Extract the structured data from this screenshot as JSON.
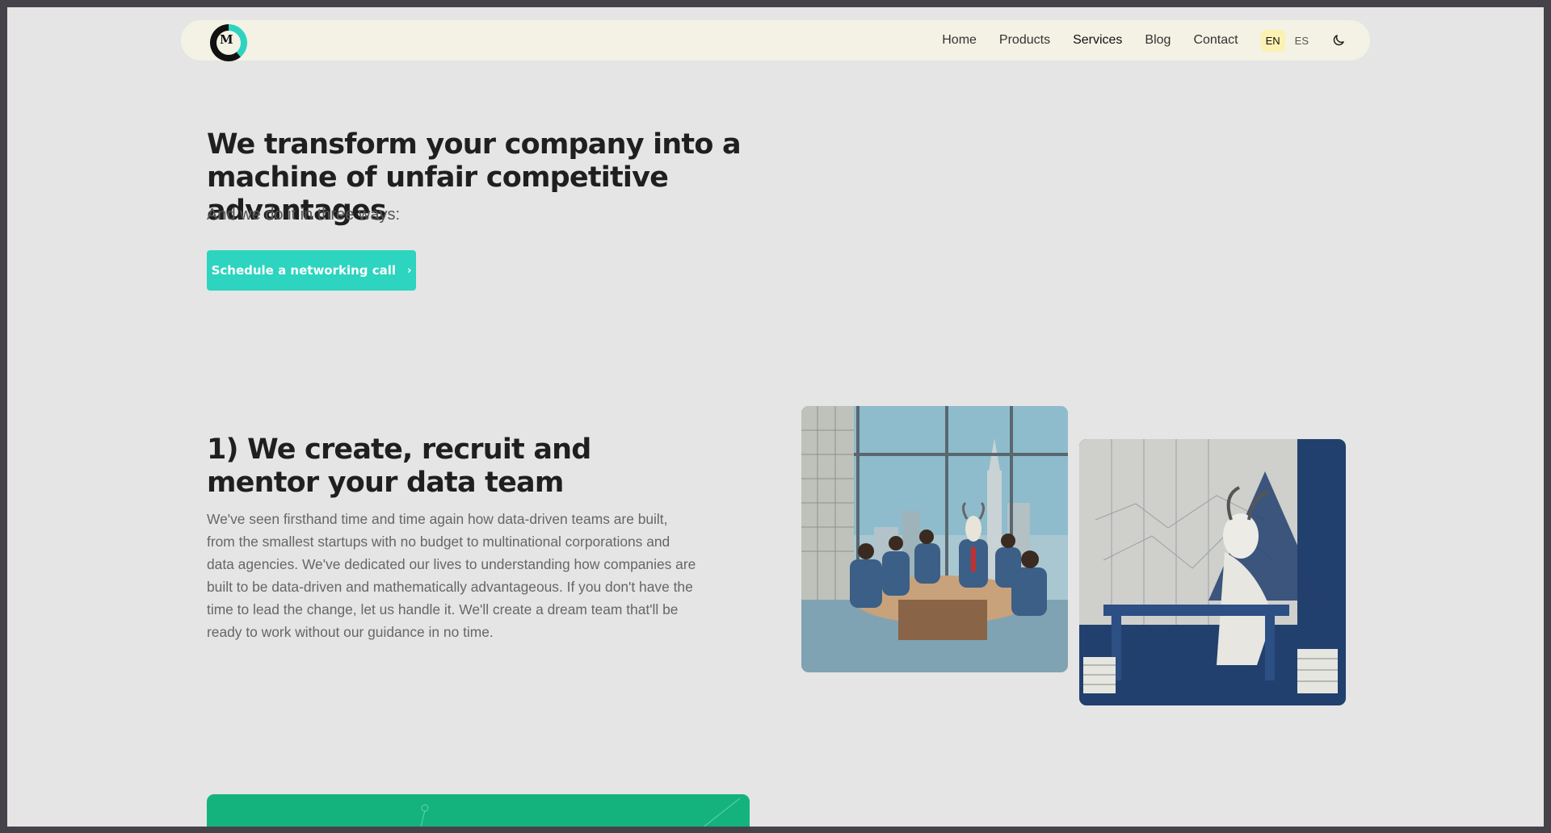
{
  "nav": {
    "logo_text": "M",
    "links": [
      {
        "label": "Home"
      },
      {
        "label": "Products"
      },
      {
        "label": "Services"
      },
      {
        "label": "Blog"
      },
      {
        "label": "Contact"
      }
    ],
    "languages": [
      "EN",
      "ES"
    ]
  },
  "hero": {
    "title": "We transform your company into a machine of unfair competitive advantages",
    "subtitle": "And we do it in three ways:",
    "cta_label": "Schedule a networking call"
  },
  "section1": {
    "title": "1) We create, recruit and mentor your data team",
    "body": "We've seen firsthand time and time again how data-driven teams are built, from the smallest startups with no budget to multinational corporations and data agencies. We've dedicated our lives to understanding how companies are built to be data-driven and mathematically advantageous. If you don't have the time to lead the change, let us handle it. We'll create a dream team that'll be ready to work without our guidance in no time."
  },
  "colors": {
    "accent": "#2dd4bf",
    "nav_bg": "#f3f2e4",
    "page_bg": "#e5e5e5",
    "green_card": "#14b37d",
    "lang_selected": "#fbf1b2"
  }
}
